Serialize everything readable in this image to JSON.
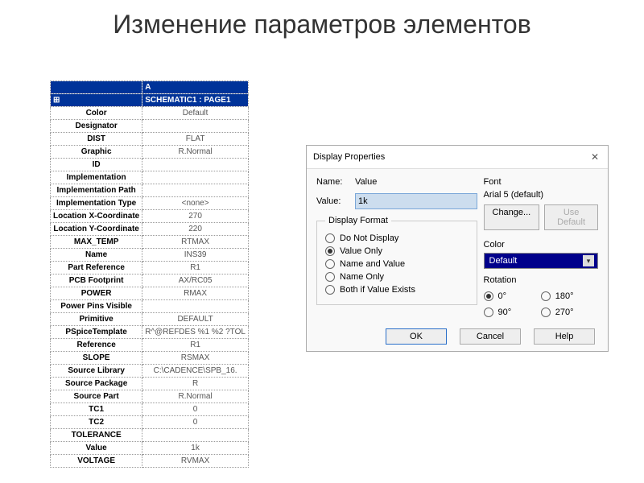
{
  "title": "Изменение параметров элементов",
  "table": {
    "colHeader": "A",
    "subHeader": "SCHEMATIC1 : PAGE1",
    "rows": [
      {
        "label": "Color",
        "value": "Default"
      },
      {
        "label": "Designator",
        "value": ""
      },
      {
        "label": "DIST",
        "value": "FLAT"
      },
      {
        "label": "Graphic",
        "value": "R.Normal"
      },
      {
        "label": "ID",
        "value": ""
      },
      {
        "label": "Implementation",
        "value": ""
      },
      {
        "label": "Implementation Path",
        "value": ""
      },
      {
        "label": "Implementation Type",
        "value": "<none>"
      },
      {
        "label": "Location X-Coordinate",
        "value": "270"
      },
      {
        "label": "Location Y-Coordinate",
        "value": "220"
      },
      {
        "label": "MAX_TEMP",
        "value": "RTMAX"
      },
      {
        "label": "Name",
        "value": "INS39"
      },
      {
        "label": "Part Reference",
        "value": "R1"
      },
      {
        "label": "PCB Footprint",
        "value": "AX/RC05"
      },
      {
        "label": "POWER",
        "value": "RMAX"
      },
      {
        "label": "Power Pins Visible",
        "value": ""
      },
      {
        "label": "Primitive",
        "value": "DEFAULT"
      },
      {
        "label": "PSpiceTemplate",
        "value": "R^@REFDES %1 %2 ?TOL"
      },
      {
        "label": "Reference",
        "value": "R1"
      },
      {
        "label": "SLOPE",
        "value": "RSMAX"
      },
      {
        "label": "Source Library",
        "value": "C:\\CADENCE\\SPB_16."
      },
      {
        "label": "Source Package",
        "value": "R"
      },
      {
        "label": "Source Part",
        "value": "R.Normal"
      },
      {
        "label": "TC1",
        "value": "0"
      },
      {
        "label": "TC2",
        "value": "0"
      },
      {
        "label": "TOLERANCE",
        "value": ""
      },
      {
        "label": "Value",
        "value": "1k"
      },
      {
        "label": "VOLTAGE",
        "value": "RVMAX"
      }
    ]
  },
  "dialog": {
    "title": "Display Properties",
    "nameLabel": "Name:",
    "nameValue": "Value",
    "valueLabel": "Value:",
    "valueInput": "1k",
    "formatGroup": "Display Format",
    "formatOptions": [
      "Do Not Display",
      "Value Only",
      "Name and Value",
      "Name Only",
      "Both if Value Exists"
    ],
    "formatSelected": 1,
    "fontGroup": "Font",
    "fontValue": "Arial 5 (default)",
    "changeBtn": "Change...",
    "useDefaultBtn": "Use Default",
    "colorGroup": "Color",
    "colorValue": "Default",
    "rotationGroup": "Rotation",
    "rotationOptions": [
      "0°",
      "180°",
      "90°",
      "270°"
    ],
    "rotationSelected": 0,
    "okBtn": "OK",
    "cancelBtn": "Cancel",
    "helpBtn": "Help"
  }
}
